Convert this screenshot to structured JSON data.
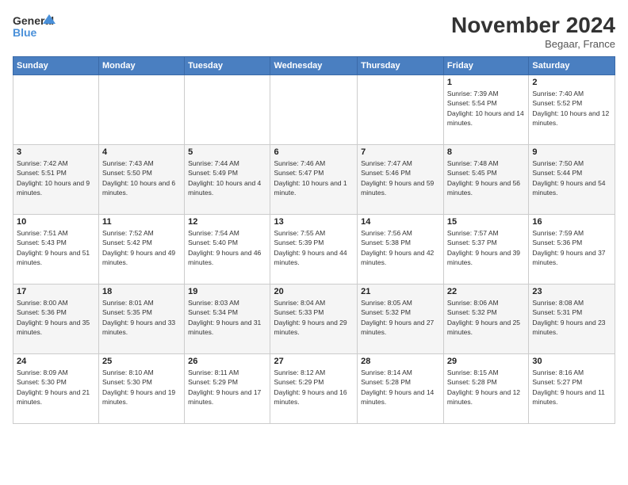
{
  "header": {
    "logo_line1": "General",
    "logo_line2": "Blue",
    "month_title": "November 2024",
    "location": "Begaar, France"
  },
  "weekdays": [
    "Sunday",
    "Monday",
    "Tuesday",
    "Wednesday",
    "Thursday",
    "Friday",
    "Saturday"
  ],
  "weeks": [
    [
      {
        "day": "",
        "info": ""
      },
      {
        "day": "",
        "info": ""
      },
      {
        "day": "",
        "info": ""
      },
      {
        "day": "",
        "info": ""
      },
      {
        "day": "",
        "info": ""
      },
      {
        "day": "1",
        "info": "Sunrise: 7:39 AM\nSunset: 5:54 PM\nDaylight: 10 hours and 14 minutes."
      },
      {
        "day": "2",
        "info": "Sunrise: 7:40 AM\nSunset: 5:52 PM\nDaylight: 10 hours and 12 minutes."
      }
    ],
    [
      {
        "day": "3",
        "info": "Sunrise: 7:42 AM\nSunset: 5:51 PM\nDaylight: 10 hours and 9 minutes."
      },
      {
        "day": "4",
        "info": "Sunrise: 7:43 AM\nSunset: 5:50 PM\nDaylight: 10 hours and 6 minutes."
      },
      {
        "day": "5",
        "info": "Sunrise: 7:44 AM\nSunset: 5:49 PM\nDaylight: 10 hours and 4 minutes."
      },
      {
        "day": "6",
        "info": "Sunrise: 7:46 AM\nSunset: 5:47 PM\nDaylight: 10 hours and 1 minute."
      },
      {
        "day": "7",
        "info": "Sunrise: 7:47 AM\nSunset: 5:46 PM\nDaylight: 9 hours and 59 minutes."
      },
      {
        "day": "8",
        "info": "Sunrise: 7:48 AM\nSunset: 5:45 PM\nDaylight: 9 hours and 56 minutes."
      },
      {
        "day": "9",
        "info": "Sunrise: 7:50 AM\nSunset: 5:44 PM\nDaylight: 9 hours and 54 minutes."
      }
    ],
    [
      {
        "day": "10",
        "info": "Sunrise: 7:51 AM\nSunset: 5:43 PM\nDaylight: 9 hours and 51 minutes."
      },
      {
        "day": "11",
        "info": "Sunrise: 7:52 AM\nSunset: 5:42 PM\nDaylight: 9 hours and 49 minutes."
      },
      {
        "day": "12",
        "info": "Sunrise: 7:54 AM\nSunset: 5:40 PM\nDaylight: 9 hours and 46 minutes."
      },
      {
        "day": "13",
        "info": "Sunrise: 7:55 AM\nSunset: 5:39 PM\nDaylight: 9 hours and 44 minutes."
      },
      {
        "day": "14",
        "info": "Sunrise: 7:56 AM\nSunset: 5:38 PM\nDaylight: 9 hours and 42 minutes."
      },
      {
        "day": "15",
        "info": "Sunrise: 7:57 AM\nSunset: 5:37 PM\nDaylight: 9 hours and 39 minutes."
      },
      {
        "day": "16",
        "info": "Sunrise: 7:59 AM\nSunset: 5:36 PM\nDaylight: 9 hours and 37 minutes."
      }
    ],
    [
      {
        "day": "17",
        "info": "Sunrise: 8:00 AM\nSunset: 5:36 PM\nDaylight: 9 hours and 35 minutes."
      },
      {
        "day": "18",
        "info": "Sunrise: 8:01 AM\nSunset: 5:35 PM\nDaylight: 9 hours and 33 minutes."
      },
      {
        "day": "19",
        "info": "Sunrise: 8:03 AM\nSunset: 5:34 PM\nDaylight: 9 hours and 31 minutes."
      },
      {
        "day": "20",
        "info": "Sunrise: 8:04 AM\nSunset: 5:33 PM\nDaylight: 9 hours and 29 minutes."
      },
      {
        "day": "21",
        "info": "Sunrise: 8:05 AM\nSunset: 5:32 PM\nDaylight: 9 hours and 27 minutes."
      },
      {
        "day": "22",
        "info": "Sunrise: 8:06 AM\nSunset: 5:32 PM\nDaylight: 9 hours and 25 minutes."
      },
      {
        "day": "23",
        "info": "Sunrise: 8:08 AM\nSunset: 5:31 PM\nDaylight: 9 hours and 23 minutes."
      }
    ],
    [
      {
        "day": "24",
        "info": "Sunrise: 8:09 AM\nSunset: 5:30 PM\nDaylight: 9 hours and 21 minutes."
      },
      {
        "day": "25",
        "info": "Sunrise: 8:10 AM\nSunset: 5:30 PM\nDaylight: 9 hours and 19 minutes."
      },
      {
        "day": "26",
        "info": "Sunrise: 8:11 AM\nSunset: 5:29 PM\nDaylight: 9 hours and 17 minutes."
      },
      {
        "day": "27",
        "info": "Sunrise: 8:12 AM\nSunset: 5:29 PM\nDaylight: 9 hours and 16 minutes."
      },
      {
        "day": "28",
        "info": "Sunrise: 8:14 AM\nSunset: 5:28 PM\nDaylight: 9 hours and 14 minutes."
      },
      {
        "day": "29",
        "info": "Sunrise: 8:15 AM\nSunset: 5:28 PM\nDaylight: 9 hours and 12 minutes."
      },
      {
        "day": "30",
        "info": "Sunrise: 8:16 AM\nSunset: 5:27 PM\nDaylight: 9 hours and 11 minutes."
      }
    ]
  ]
}
